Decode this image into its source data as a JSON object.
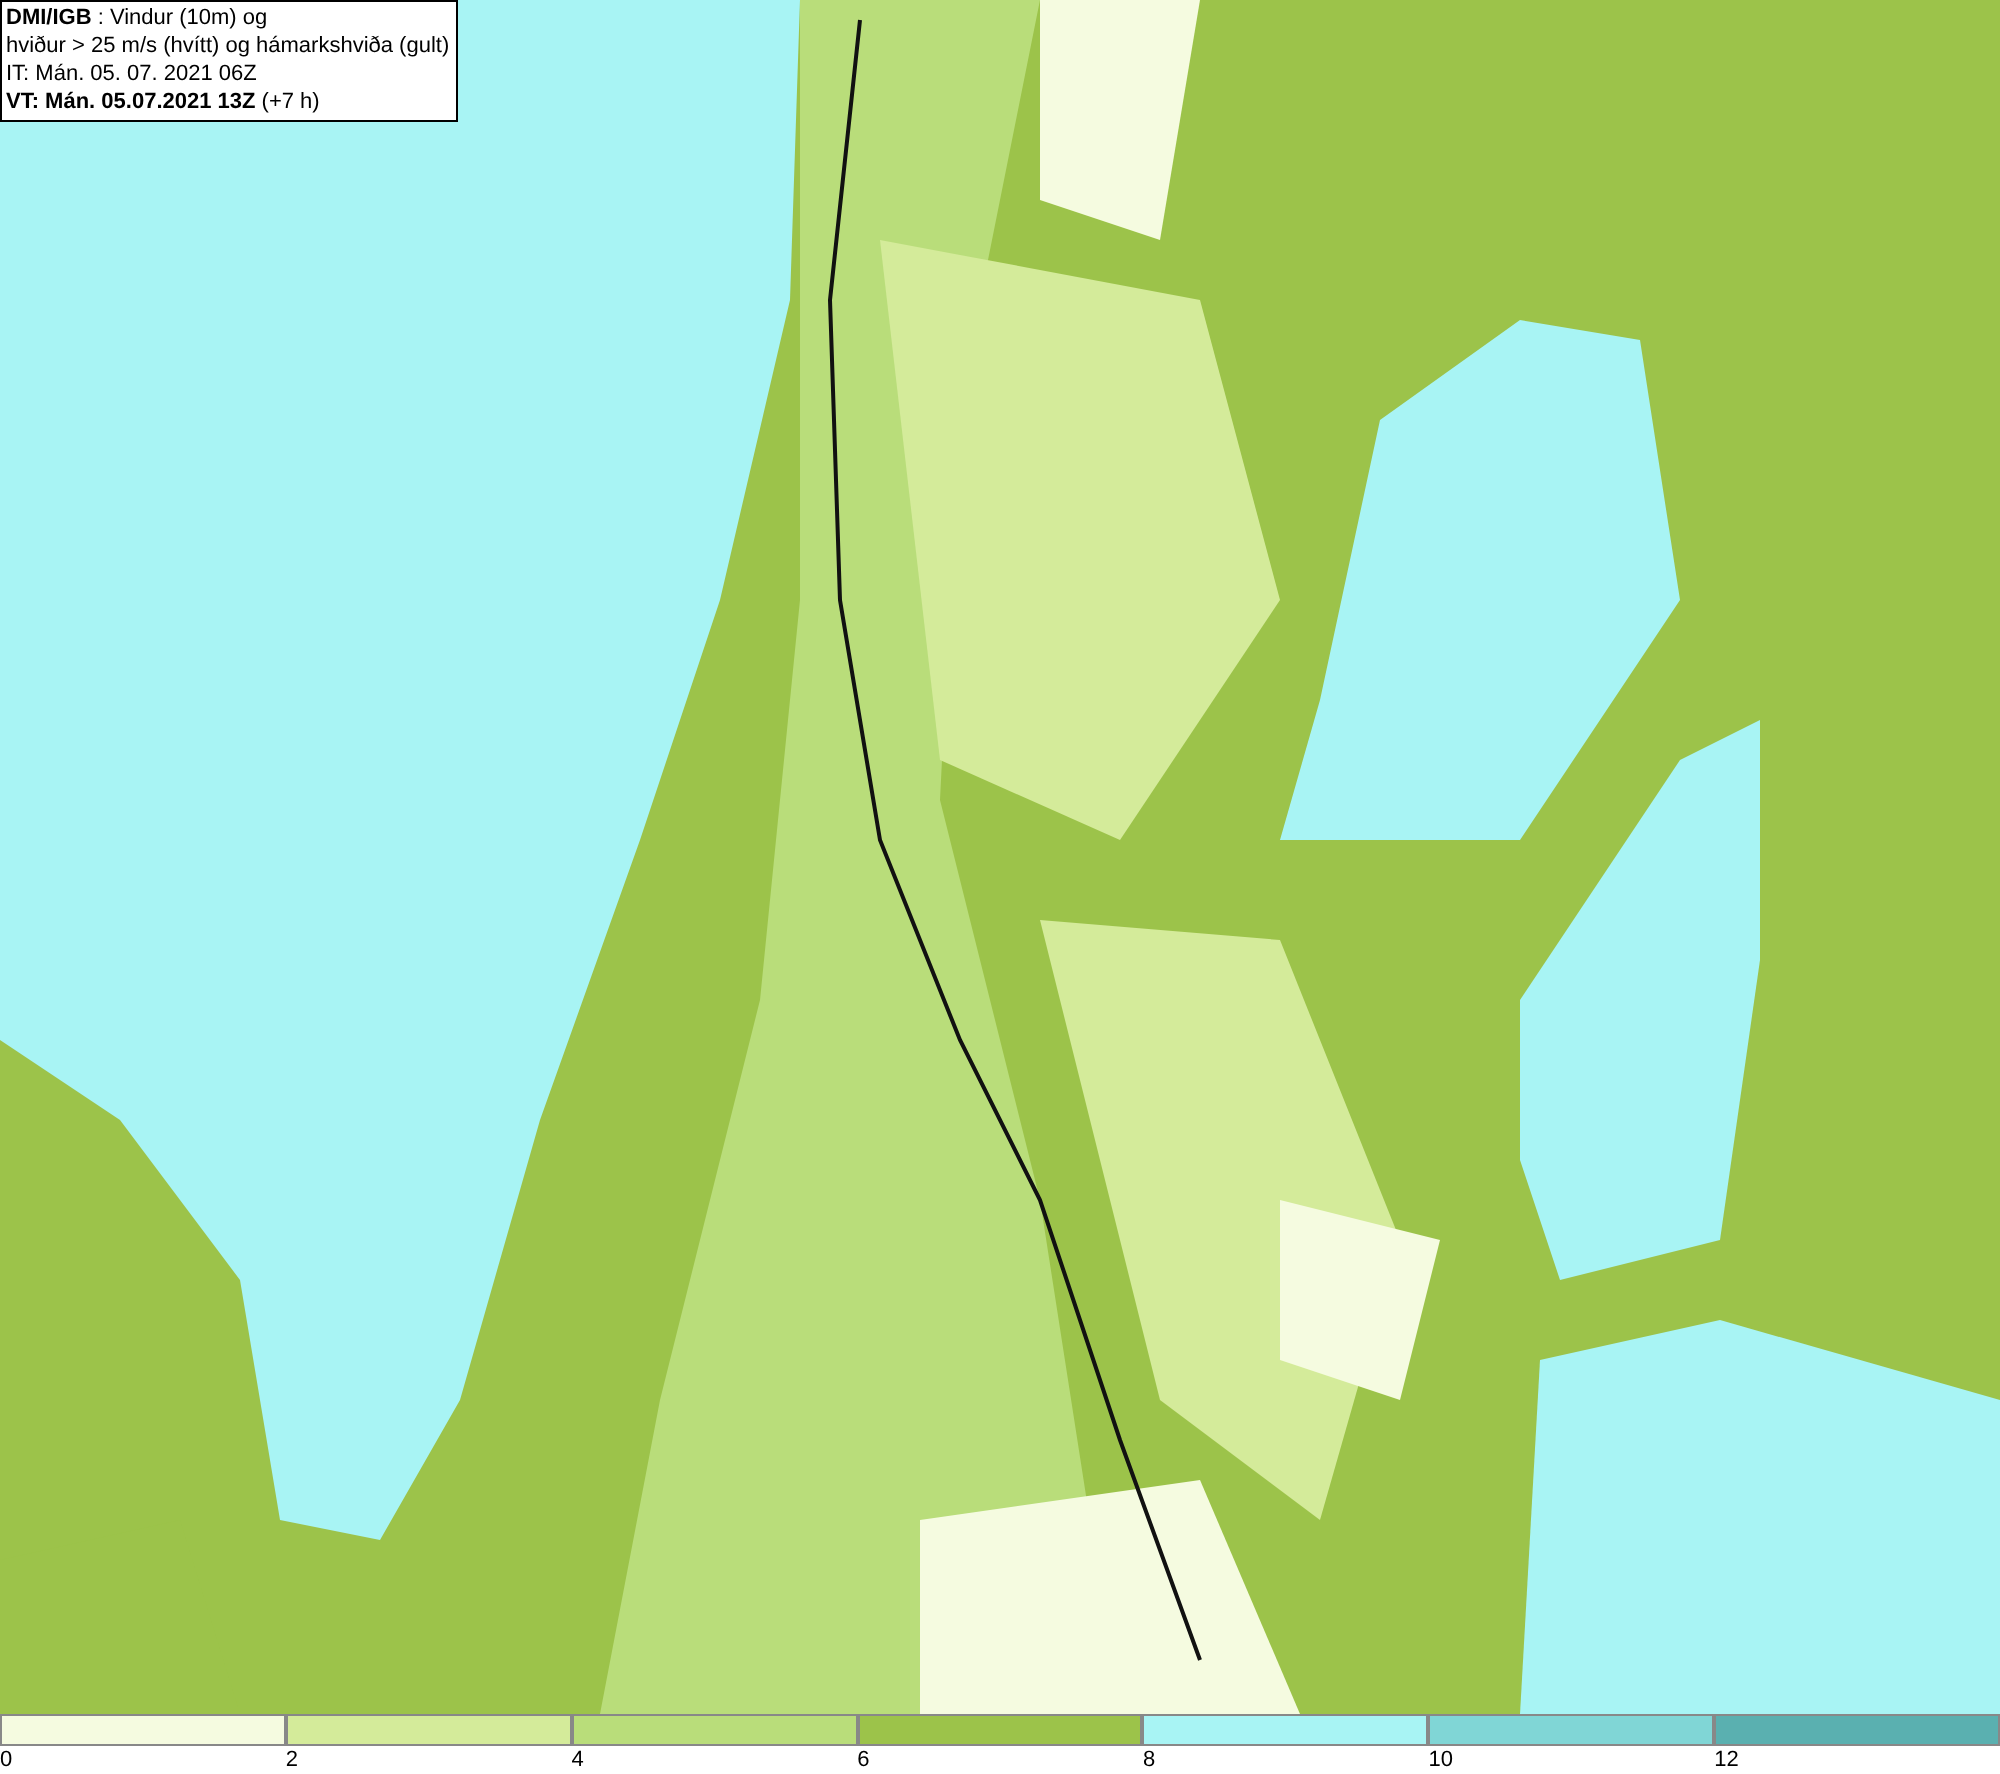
{
  "title_box": {
    "lines": [
      "**DMI/IGB** : Vindur (10m) og",
      "hviður > 25 m/s (hvítt) og hámarkshviða (gult)",
      "IT: Mán. 05. 07. 2021 06Z",
      "**VT: Mán. 05.07.2021 13Z** (+7 h)"
    ]
  },
  "legend": {
    "bins": [
      {
        "color": "#f5fbe0",
        "label": "0"
      },
      {
        "color": "#d4eb9a",
        "label": "2"
      },
      {
        "color": "#b9dd7a",
        "label": "4"
      },
      {
        "color": "#9cc34a",
        "label": "6"
      },
      {
        "color": "#a8f4f4",
        "label": "8"
      },
      {
        "color": "#80d6d6",
        "label": "10"
      },
      {
        "color": "#5ab0b0",
        "label": "12"
      }
    ]
  }
}
